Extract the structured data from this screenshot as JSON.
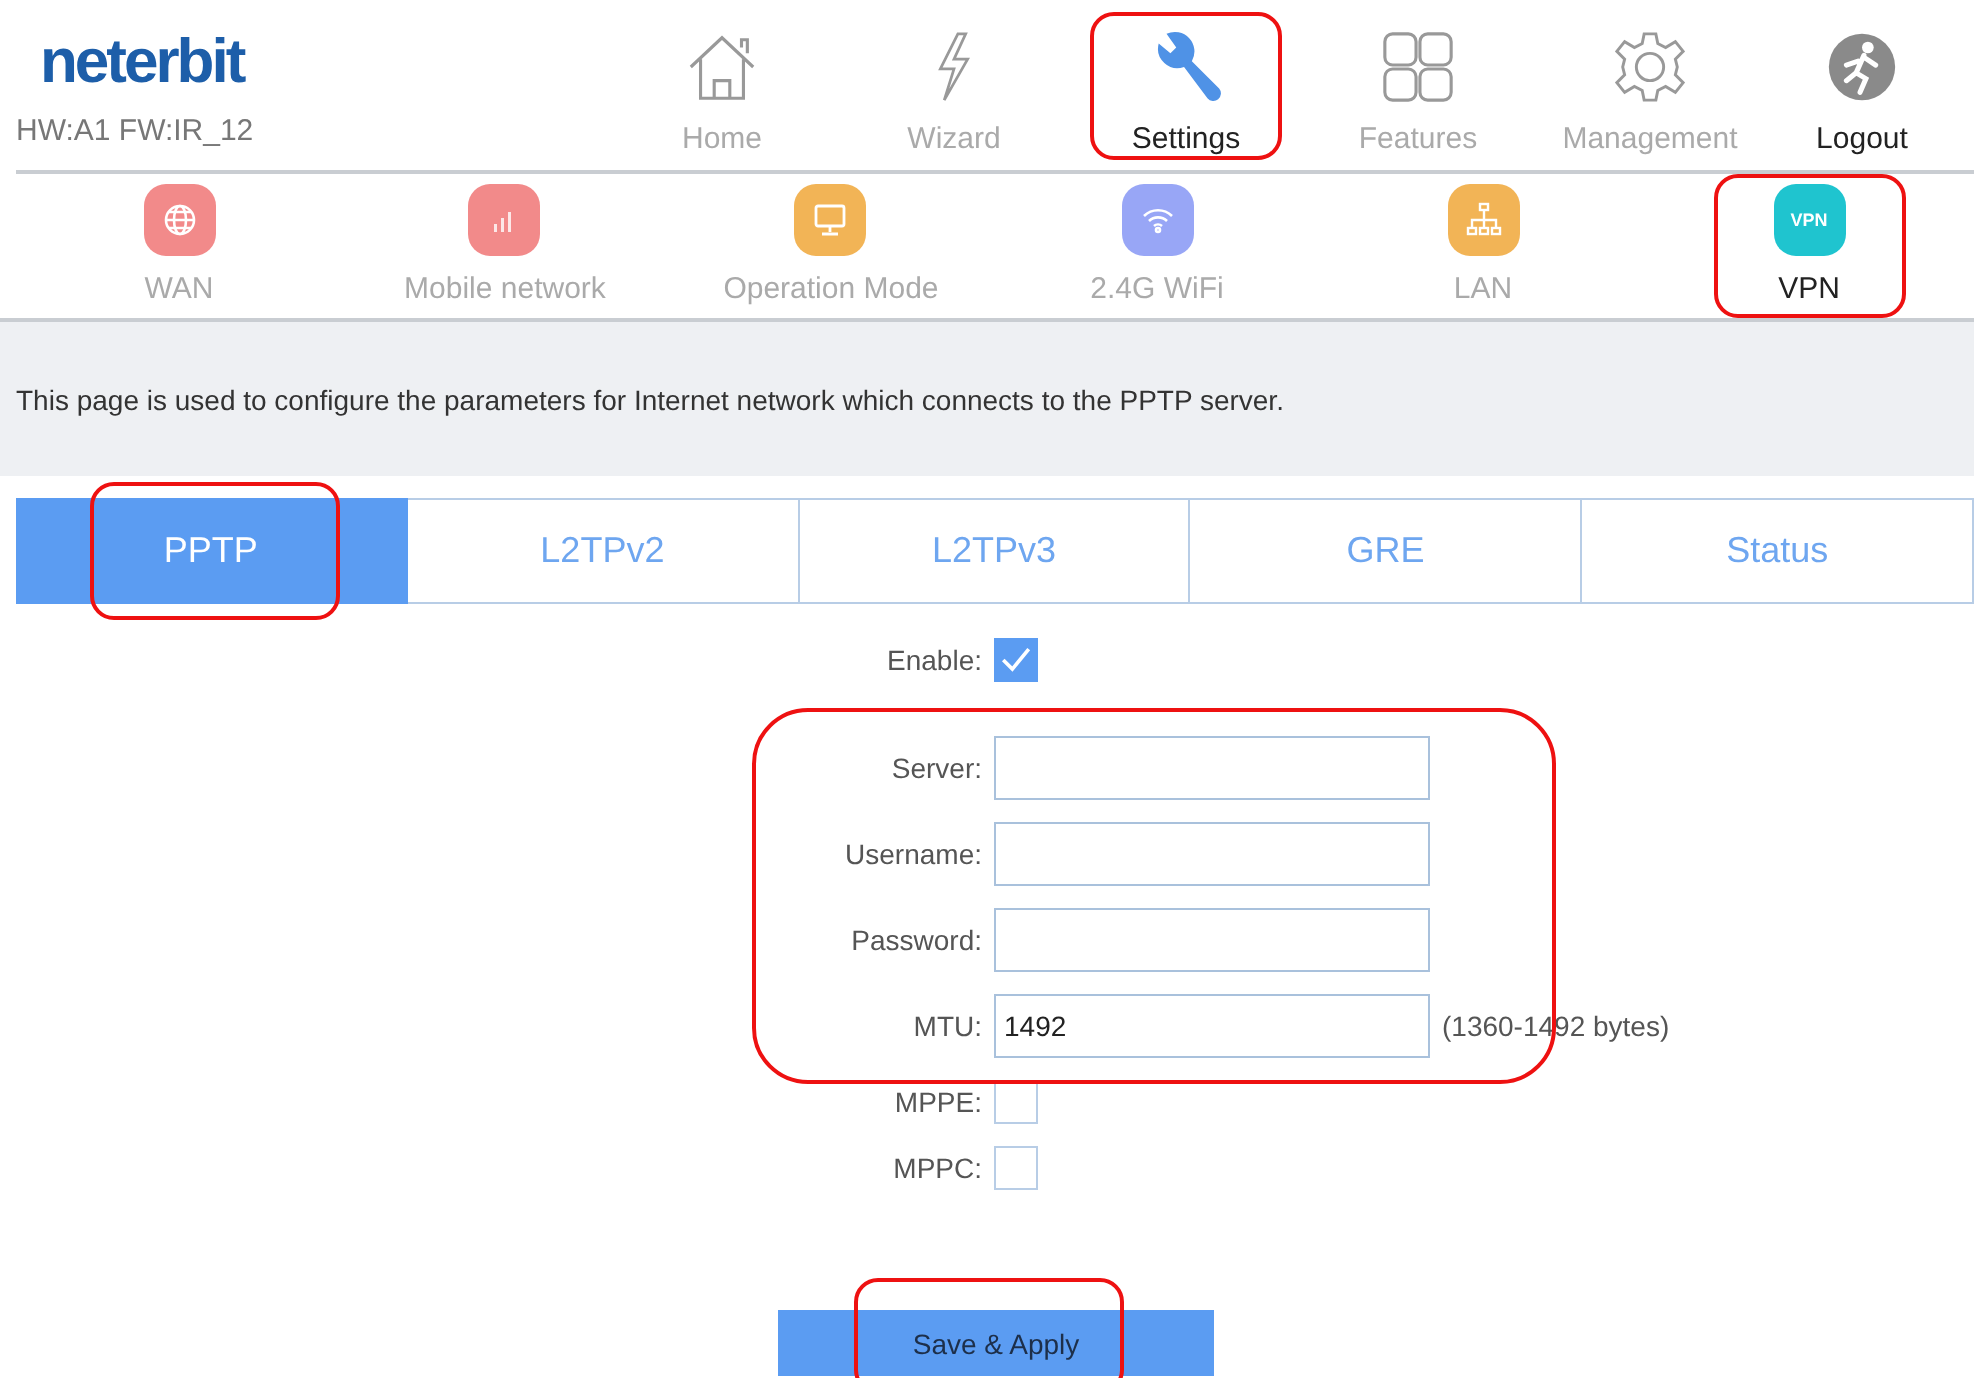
{
  "logo": "neterbit",
  "version": "HW:A1 FW:IR_12",
  "nav": [
    {
      "label": "Home",
      "selected": false,
      "highlighted": false
    },
    {
      "label": "Wizard",
      "selected": false,
      "highlighted": false
    },
    {
      "label": "Settings",
      "selected": true,
      "highlighted": true
    },
    {
      "label": "Features",
      "selected": false,
      "highlighted": false
    },
    {
      "label": "Management",
      "selected": false,
      "highlighted": false
    },
    {
      "label": "Logout",
      "highlighted": false,
      "kind": "action"
    }
  ],
  "subnav": [
    {
      "label": "WAN",
      "color": "#f28a8a",
      "selected": false,
      "highlighted": false
    },
    {
      "label": "Mobile network",
      "color": "#f28a8a",
      "selected": false,
      "highlighted": false
    },
    {
      "label": "Operation Mode",
      "color": "#f2b456",
      "selected": false,
      "highlighted": false
    },
    {
      "label": "2.4G WiFi",
      "color": "#98a6f6",
      "selected": false,
      "highlighted": false
    },
    {
      "label": "LAN",
      "color": "#f2b456",
      "selected": false,
      "highlighted": false
    },
    {
      "label": "VPN",
      "badge": "VPN",
      "color": "#1fc4cf",
      "selected": true,
      "highlighted": true
    }
  ],
  "description": "This page is used to configure the parameters for Internet network which connects to the PPTP server.",
  "tabs": [
    {
      "label": "PPTP",
      "selected": true,
      "highlighted": true
    },
    {
      "label": "L2TPv2",
      "selected": false,
      "highlighted": false
    },
    {
      "label": "L2TPv3",
      "selected": false,
      "highlighted": false
    },
    {
      "label": "GRE",
      "selected": false,
      "highlighted": false
    },
    {
      "label": "Status",
      "selected": false,
      "highlighted": false
    }
  ],
  "enable": {
    "label": "Enable:",
    "checked": true
  },
  "fields_highlighted": true,
  "fields": [
    {
      "label": "Server:"
    },
    {
      "label": "Username:"
    },
    {
      "label": "Password:"
    },
    {
      "label": "MTU:",
      "value": "1492",
      "note": "(1360-1492 bytes)"
    }
  ],
  "options": [
    {
      "label": "MPPE:",
      "checked": false
    },
    {
      "label": "MPPC:",
      "checked": false
    }
  ],
  "save": {
    "label": "Save & Apply",
    "highlighted": true
  }
}
